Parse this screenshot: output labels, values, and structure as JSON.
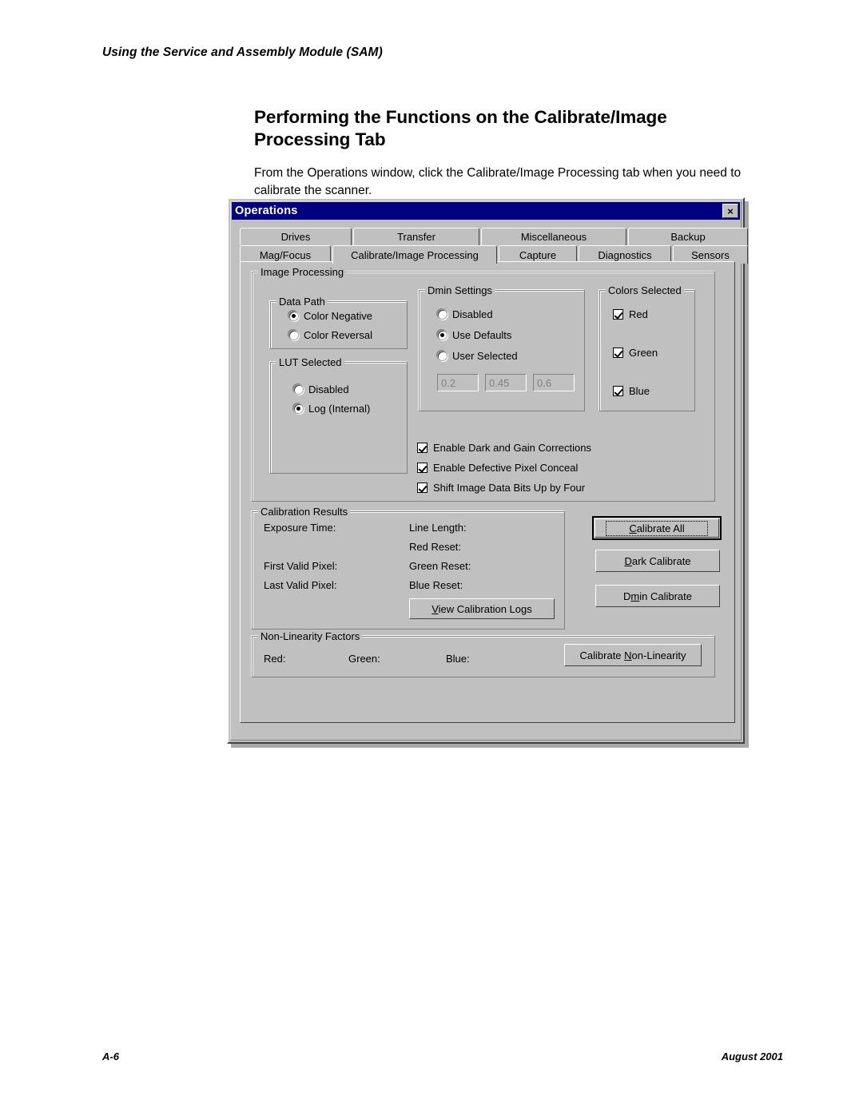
{
  "page": {
    "running_head": "Using the Service and Assembly Module (SAM)",
    "title": "Performing the Functions on the Calibrate/Image Processing Tab",
    "body": "From the Operations window, click the Calibrate/Image Processing tab when you need to calibrate the scanner.",
    "footer_left": "A-6",
    "footer_right": "August 2001"
  },
  "dialog": {
    "title": "Operations",
    "close_label": "×",
    "tabs_row1": [
      {
        "label": "Drives",
        "selected": false
      },
      {
        "label": "Transfer",
        "selected": false
      },
      {
        "label": "Miscellaneous",
        "selected": false
      },
      {
        "label": "Backup",
        "selected": false
      }
    ],
    "tabs_row2": [
      {
        "label": "Mag/Focus",
        "selected": false
      },
      {
        "label": "Calibrate/Image Processing",
        "selected": true
      },
      {
        "label": "Capture",
        "selected": false
      },
      {
        "label": "Diagnostics",
        "selected": false
      },
      {
        "label": "Sensors",
        "selected": false
      }
    ],
    "image_processing": {
      "legend": "Image Processing",
      "data_path": {
        "legend": "Data Path",
        "options": [
          {
            "label": "Color Negative",
            "selected": true
          },
          {
            "label": "Color Reversal",
            "selected": false
          }
        ]
      },
      "lut_selected": {
        "legend": "LUT Selected",
        "options": [
          {
            "label": "Disabled",
            "selected": false
          },
          {
            "label": "Log (Internal)",
            "selected": true
          }
        ]
      },
      "dmin_settings": {
        "legend": "Dmin Settings",
        "options": [
          {
            "label": "Disabled",
            "selected": false
          },
          {
            "label": "Use Defaults",
            "selected": true
          },
          {
            "label": "User Selected",
            "selected": false
          }
        ],
        "fields": [
          {
            "value": "0.2"
          },
          {
            "value": "0.45"
          },
          {
            "value": "0.6"
          }
        ]
      },
      "colors_selected": {
        "legend": "Colors Selected",
        "options": [
          {
            "label": "Red",
            "checked": true
          },
          {
            "label": "Green",
            "checked": true
          },
          {
            "label": "Blue",
            "checked": true
          }
        ]
      },
      "checkboxes": [
        {
          "label": "Enable Dark and Gain Corrections",
          "checked": true
        },
        {
          "label": "Enable Defective Pixel Conceal",
          "checked": true
        },
        {
          "label": "Shift Image Data Bits Up by Four",
          "checked": true
        }
      ]
    },
    "calibration_results": {
      "legend": "Calibration Results",
      "col1": [
        "Exposure Time:",
        "First Valid Pixel:",
        "Last Valid Pixel:"
      ],
      "col2": [
        "Line Length:",
        "Red Reset:",
        "Green Reset:",
        "Blue Reset:"
      ],
      "view_logs_button": {
        "prefix": "",
        "accel": "V",
        "suffix": "iew Calibration Logs"
      },
      "buttons": [
        {
          "prefix": "",
          "accel": "C",
          "suffix": "alibrate All",
          "default": true
        },
        {
          "prefix": "",
          "accel": "D",
          "suffix": "ark Calibrate",
          "default": false
        },
        {
          "prefix": "D",
          "accel": "m",
          "suffix": "in Calibrate",
          "default": false
        }
      ]
    },
    "non_linearity": {
      "legend": "Non-Linearity Factors",
      "labels": [
        "Red:",
        "Green:",
        "Blue:"
      ],
      "button": {
        "prefix": "Calibrate ",
        "accel": "N",
        "suffix": "on-Linearity"
      }
    }
  }
}
